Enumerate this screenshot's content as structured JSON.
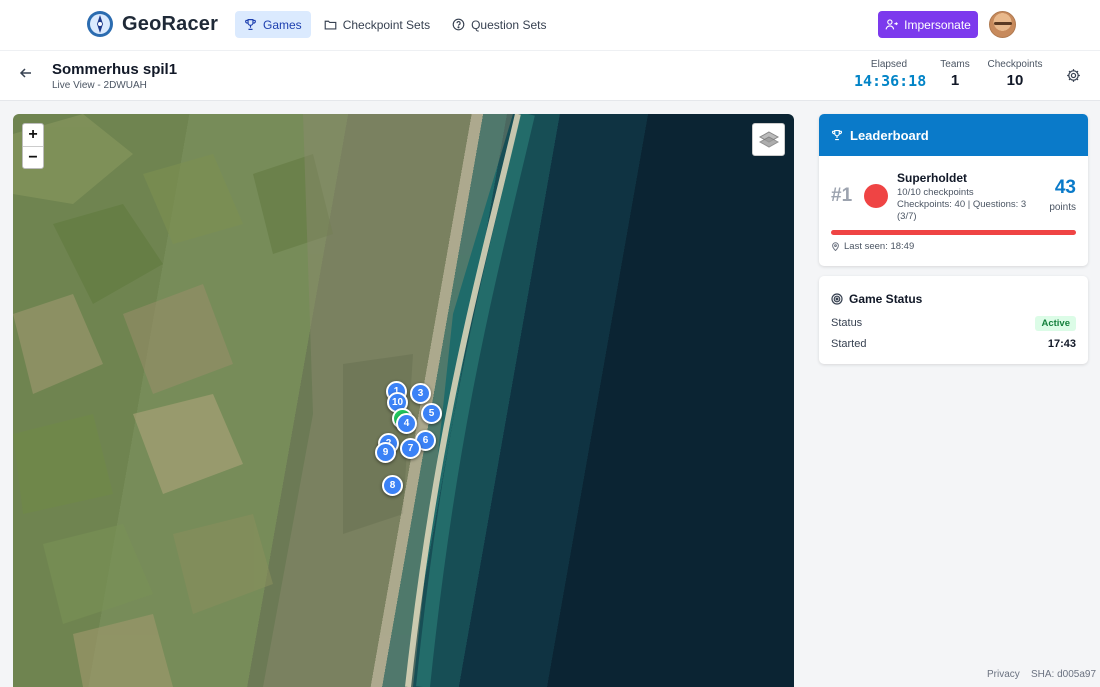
{
  "app": {
    "name": "GeoRacer"
  },
  "nav": {
    "games": "Games",
    "checkpoint_sets": "Checkpoint Sets",
    "question_sets": "Question Sets",
    "impersonate": "Impersonate"
  },
  "game": {
    "title": "Sommerhus spil1",
    "subtitle": "Live View - 2DWUAH"
  },
  "stats": {
    "elapsed_label": "Elapsed",
    "elapsed_value": "14:36:18",
    "teams_label": "Teams",
    "teams_value": "1",
    "checkpoints_label": "Checkpoints",
    "checkpoints_value": "10"
  },
  "map": {
    "zoom_in": "+",
    "zoom_out": "−",
    "markers": [
      "1",
      "10",
      "3",
      "5",
      "4",
      "6",
      "7",
      "9",
      "8",
      "2"
    ]
  },
  "leaderboard": {
    "title": "Leaderboard",
    "team": {
      "rank": "#1",
      "name": "Superholdet",
      "checkpoints": "10/10 checkpoints",
      "breakdown_1": "Checkpoints: 40 | Questions: 3",
      "breakdown_2": "(3/7)",
      "points": "43",
      "points_label": "points",
      "color": "#ef4444",
      "progress": 1.0,
      "last_seen": "Last seen: 18:49"
    }
  },
  "status": {
    "title": "Game Status",
    "status_label": "Status",
    "status_value": "Active",
    "started_label": "Started",
    "started_value": "17:43"
  },
  "footer": {
    "privacy": "Privacy",
    "sha": "SHA: d005a97"
  },
  "colors": {
    "primary": "#0a7ac9",
    "accent_purple": "#7c3aed",
    "active_nav": "#dbeafe",
    "marker": "#3b82f6"
  }
}
